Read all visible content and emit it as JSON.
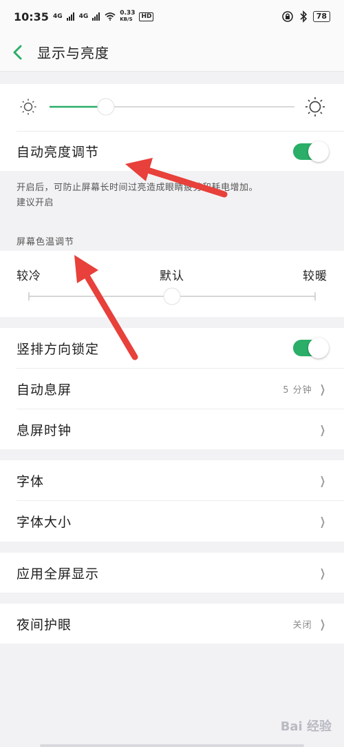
{
  "status_bar": {
    "time": "10:35",
    "signal1": "4G",
    "signal2": "4G",
    "speed_value": "0.33",
    "speed_unit": "KB/S",
    "hd_badge": "HD",
    "battery": "78"
  },
  "header": {
    "title": "显示与亮度"
  },
  "brightness": {
    "level_fraction": 0.23,
    "auto_label": "自动亮度调节",
    "auto_enabled": true,
    "description_line1": "开启后，可防止屏幕长时间过亮造成眼睛疲劳和耗电增加。",
    "description_line2": "建议开启"
  },
  "color_temp": {
    "section_label": "屏幕色温调节",
    "left_label": "较冷",
    "center_label": "默认",
    "right_label": "较暖",
    "level_fraction": 0.5
  },
  "settings": {
    "portrait_lock": {
      "label": "竖排方向锁定",
      "enabled": true
    },
    "auto_sleep": {
      "label": "自动息屏",
      "value": "5 分钟"
    },
    "sleep_clock": {
      "label": "息屏时钟"
    },
    "font": {
      "label": "字体"
    },
    "font_size": {
      "label": "字体大小"
    },
    "fullscreen_apps": {
      "label": "应用全屏显示"
    },
    "night_mode": {
      "label": "夜间护眼",
      "value": "关闭"
    }
  },
  "watermark": "Bai 经验",
  "colors": {
    "accent_green": "#2aae68",
    "arrow_red": "#e8403a",
    "background": "#f2f2f4",
    "card": "#ffffff"
  }
}
